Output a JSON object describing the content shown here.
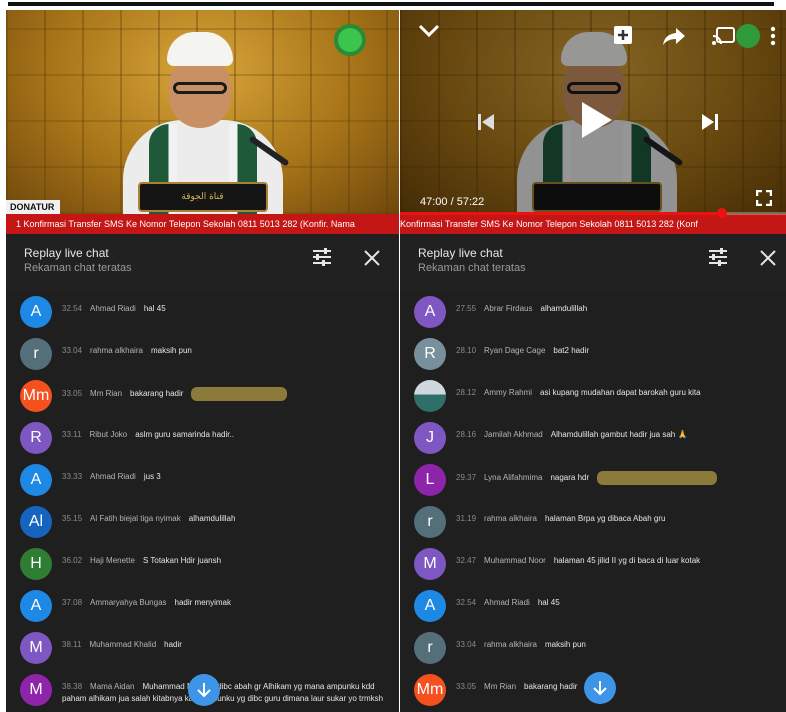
{
  "left": {
    "video": {
      "badge": "DONATUR",
      "podium_text": "قناة الجوقة"
    },
    "ticker": "1  Konfirmasi Transfer SMS Ke Nomor Telepon Sekolah 0811 5013 282 (Konfir. Nama",
    "chat": {
      "title": "Replay live chat",
      "subtitle": "Rekaman chat teratas",
      "messages": [
        {
          "initial": "A",
          "color": "#1e88e5",
          "time": "32.54",
          "author": "Ahmad Riadi",
          "text": "hal 45"
        },
        {
          "initial": "r",
          "color": "#546e7a",
          "time": "33.04",
          "author": "rahma alkhaira",
          "text": "maksih pun"
        },
        {
          "initial": "Mm",
          "color": "#f4511e",
          "time": "33.05",
          "author": "Mm Rian",
          "text": "bakarang hadir"
        },
        {
          "initial": "R",
          "color": "#7e57c2",
          "time": "33.11",
          "author": "Ribut Joko",
          "text": "aslm guru samarinda hadir.."
        },
        {
          "initial": "A",
          "color": "#1e88e5",
          "time": "33.33",
          "author": "Ahmad Riadi",
          "text": "jus 3"
        },
        {
          "initial": "Al",
          "color": "#1565c0",
          "time": "35.15",
          "author": "Al Fatih biejal tiga nyimak",
          "text": "alhamdulillah"
        },
        {
          "initial": "H",
          "color": "#2e7d32",
          "time": "36.02",
          "author": "Haji Menette",
          "text": "S Totakan Hdir juansh"
        },
        {
          "initial": "A",
          "color": "#1e88e5",
          "time": "37.08",
          "author": "Ammaryahya Bungas",
          "text": "hadir menyimak"
        },
        {
          "initial": "M",
          "color": "#7e57c2",
          "time": "38.11",
          "author": "Muhammad Khalid",
          "text": "hadir"
        },
        {
          "initial": "M",
          "color": "#8e24aa",
          "time": "38.38",
          "author": "Mama Aidan",
          "text": "Muhammad Noor yg dibc abah gr Alhikam yg mana ampunku kdd paham alhikam jua salah kitabnya kalu ampunku yg dibc guru dimana laur sukar yo trmksh"
        }
      ]
    }
  },
  "right": {
    "player": {
      "time_current": "47:00",
      "time_total": "57:22",
      "progress": 0.82
    },
    "ticker": "Konfirmasi Transfer SMS Ke Nomor Telepon Sekolah 0811 5013 282 (Konf",
    "chat": {
      "title": "Replay live chat",
      "subtitle": "Rekaman chat teratas",
      "messages": [
        {
          "initial": "A",
          "color": "#7e57c2",
          "time": "27.55",
          "author": "Abrar Firdaus",
          "text": "alhamdulillah"
        },
        {
          "initial": "R",
          "color": "#78909c",
          "time": "28.10",
          "author": "Ryan Dage Cage",
          "text": "bat2 hadir"
        },
        {
          "initial": "",
          "color": "#2f6f6a",
          "time": "28.12",
          "author": "Ammy Rahmi",
          "text": "asi kupang mudahan dapat barokah guru kita",
          "photo": true
        },
        {
          "initial": "J",
          "color": "#7e57c2",
          "time": "28.16",
          "author": "Jamilah Akhmad",
          "text": "Alhamdulillah gambut hadir jua sah 🙏"
        },
        {
          "initial": "L",
          "color": "#8e24aa",
          "time": "29.37",
          "author": "Lyna Alifahmima",
          "text": "nagara hdr"
        },
        {
          "initial": "r",
          "color": "#546e7a",
          "time": "31.19",
          "author": "rahma alkhaira",
          "text": "halaman Brpa yg dibaca Abah gru"
        },
        {
          "initial": "M",
          "color": "#7e57c2",
          "time": "32.47",
          "author": "Muhammad Noor",
          "text": "halaman 45 jilid II yg di baca di luar kotak"
        },
        {
          "initial": "A",
          "color": "#1e88e5",
          "time": "32.54",
          "author": "Ahmad Riadi",
          "text": "hal 45"
        },
        {
          "initial": "r",
          "color": "#546e7a",
          "time": "33.04",
          "author": "rahma alkhaira",
          "text": "maksih pun"
        },
        {
          "initial": "Mm",
          "color": "#f4511e",
          "time": "33.05",
          "author": "Mm Rian",
          "text": "bakarang hadir"
        }
      ]
    }
  },
  "icons": {
    "filter": "sliders-icon",
    "close": "close-icon",
    "scroll": "arrow-down-icon"
  }
}
